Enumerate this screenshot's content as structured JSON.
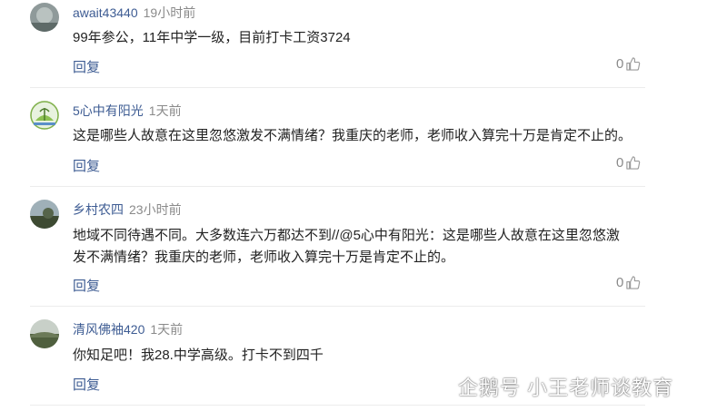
{
  "comments": [
    {
      "user": "await43440",
      "time": "19小时前",
      "text": "99年参公，11年中学一级，目前打卡工资3724",
      "reply": "回复",
      "likes": "0"
    },
    {
      "user": "5心中有阳光",
      "time": "1天前",
      "text": "这是哪些人故意在这里忽悠激发不满情绪？我重庆的老师，老师收入算完十万是肯定不止的。",
      "reply": "回复",
      "likes": "0"
    },
    {
      "user": "乡村农四",
      "time": "23小时前",
      "text_line1": "地域不同待遇不同。大多数连六万都达不到//@5心中有阳光：这是哪些人故意在这里忽悠激",
      "text_line2": "发不满情绪？我重庆的老师，老师收入算完十万是肯定不止的。",
      "reply": "回复",
      "likes": "0"
    },
    {
      "user": "清风佛袖420",
      "time": "1天前",
      "text": "你知足吧！我28.中学高级。打卡不到四千",
      "reply": "回复"
    }
  ],
  "watermark": "企鹅号 小王老师谈教育",
  "colors": {
    "username": "#3e5c93",
    "meta": "#8a8a8a",
    "text": "#222222"
  }
}
